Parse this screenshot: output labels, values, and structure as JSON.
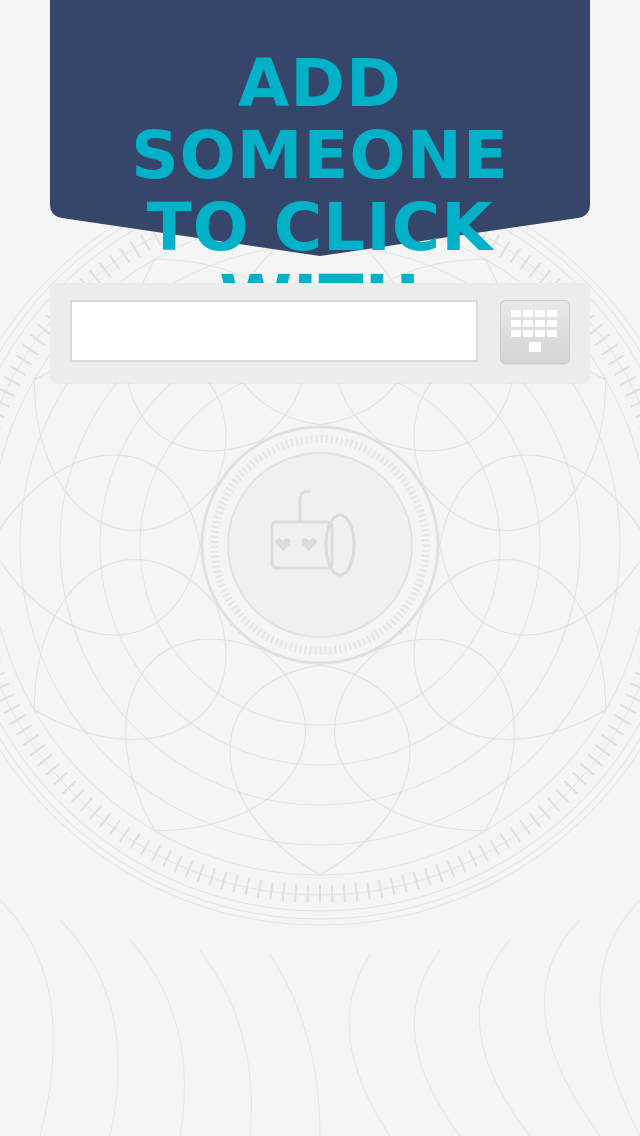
{
  "header": {
    "title": "ADD SOMEONE\nTO CLICK WITH",
    "background_color": "#36466a",
    "text_color": "#00b1c8"
  },
  "search": {
    "value": "",
    "placeholder": ""
  },
  "icons": {
    "keypad": "keypad-icon",
    "center_emblem": "slot-machine-emblem"
  }
}
